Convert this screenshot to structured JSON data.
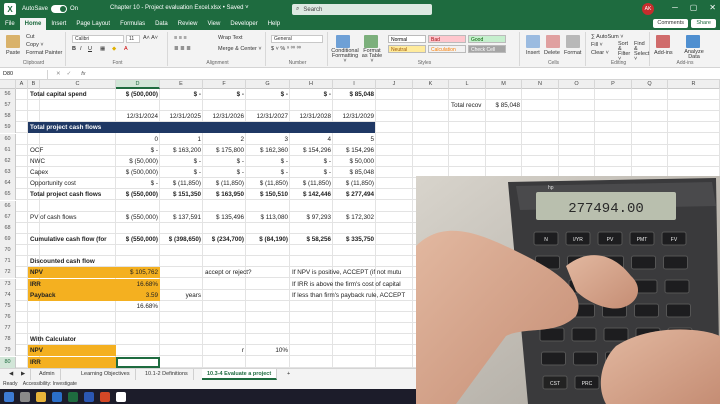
{
  "titlebar": {
    "autosave_label": "AutoSave",
    "autosave_state": "On",
    "doc_title": "Chapter 10 - Project evaluation Excel.xlsx  •  Saved ˅",
    "search_placeholder": "Search",
    "user_initials": "AK"
  },
  "menu": {
    "tabs": [
      "File",
      "Home",
      "Insert",
      "Page Layout",
      "Formulas",
      "Data",
      "Review",
      "View",
      "Developer",
      "Help"
    ],
    "active": "Home",
    "comments_label": "Comments",
    "share_label": "Share"
  },
  "ribbon": {
    "clipboard": {
      "paste": "Paste",
      "cut": "Cut",
      "copy": "Copy ˅",
      "format_painter": "Format Painter",
      "label": "Clipboard"
    },
    "font": {
      "name": "Calibri",
      "size": "11",
      "label": "Font"
    },
    "alignment": {
      "wrap": "Wrap Text",
      "merge": "Merge & Center ˅",
      "label": "Alignment"
    },
    "number": {
      "format": "General",
      "symbols": "$ ˅ % ⁹ ⁰⁰ ⁰⁰",
      "label": "Number"
    },
    "styles": {
      "conditional": "Conditional Formatting ˅",
      "format_table": "Format as Table ˅",
      "label": "Styles",
      "cells": [
        {
          "name": "Normal",
          "bg": "#ffffff",
          "fg": "#000000"
        },
        {
          "name": "Bad",
          "bg": "#ffc7ce",
          "fg": "#9c0006"
        },
        {
          "name": "Good",
          "bg": "#c6efce",
          "fg": "#006100"
        },
        {
          "name": "Neutral",
          "bg": "#ffeb9c",
          "fg": "#9c5700"
        },
        {
          "name": "Calculation",
          "bg": "#f2f2f2",
          "fg": "#fa7d00"
        },
        {
          "name": "Check Cell",
          "bg": "#a5a5a5",
          "fg": "#ffffff"
        }
      ]
    },
    "cells_group": {
      "insert": "Insert",
      "delete": "Delete",
      "format": "Format",
      "label": "Cells"
    },
    "editing": {
      "autosum": "∑ AutoSum ˅",
      "fill": "Fill ˅",
      "clear": "Clear ˅",
      "sort": "Sort & Filter ˅",
      "find": "Find & Select ˅",
      "label": "Editing"
    },
    "addins": {
      "addins": "Add-ins",
      "analyze": "Analyze Data",
      "label": "Add-ins"
    }
  },
  "formula_bar": {
    "name_box": "D80",
    "fx": "fx",
    "content": ""
  },
  "columns": [
    "A",
    "B",
    "C",
    "D",
    "E",
    "F",
    "G",
    "H",
    "I",
    "J",
    "K",
    "L",
    "M",
    "N",
    "O",
    "P",
    "Q",
    "R"
  ],
  "selected_column": "D",
  "selected_row": "80",
  "rows": [
    {
      "n": "56",
      "cells": {
        "A": "Total capital spend",
        "D": "$ (500,000)",
        "E": "$          -",
        "F": "$          -",
        "G": "$          -",
        "H": "$          -",
        "I": "$    85,048",
        "L": "",
        "M": ""
      }
    },
    {
      "n": "57",
      "cells": {
        "L": "Total recov",
        "M": "$      85,048"
      }
    },
    {
      "n": "58",
      "cells": {
        "D": "12/31/2024",
        "E": "12/31/2025",
        "F": "12/31/2026",
        "G": "12/31/2027",
        "H": "12/31/2028",
        "I": "12/31/2029"
      }
    },
    {
      "n": "59",
      "cells": {
        "A": "Total project cash flows"
      }
    },
    {
      "n": "60",
      "cells": {
        "D": "0",
        "E": "1",
        "F": "2",
        "G": "3",
        "H": "4",
        "I": "5"
      }
    },
    {
      "n": "61",
      "cells": {
        "A": "OCF",
        "D": "$          -",
        "E": "$  163,200",
        "F": "$  175,800",
        "G": "$  162,360",
        "H": "$  154,296",
        "I": "$  154,296"
      }
    },
    {
      "n": "62",
      "cells": {
        "A": "NWC",
        "D": "$          (50,000)",
        "E": "$          -",
        "F": "$          -",
        "G": "$          -",
        "H": "$          -",
        "I": "$    50,000"
      }
    },
    {
      "n": "63",
      "cells": {
        "A": "Capex",
        "D": "$  (500,000)",
        "E": "$          -",
        "F": "$          -",
        "G": "$          -",
        "H": "$          -",
        "I": "$    85,048"
      }
    },
    {
      "n": "64",
      "cells": {
        "A": "Opportunity cost",
        "D": "$          -",
        "E": "$  (11,850)",
        "F": "$  (11,850)",
        "G": "$  (11,850)",
        "H": "$  (11,850)",
        "I": "$  (11,850)"
      }
    },
    {
      "n": "65",
      "cells": {
        "A": "Total project cash flows",
        "D": "$  (550,000)",
        "E": "$  151,350",
        "F": "$  163,950",
        "G": "$  150,510",
        "H": "$  142,446",
        "I": "$  277,494"
      }
    },
    {
      "n": "66",
      "cells": {}
    },
    {
      "n": "67",
      "cells": {
        "A": "PV of cash flows",
        "D": "$  (550,000)",
        "E": "$  137,591",
        "F": "$  135,496",
        "G": "$  113,080",
        "H": "$    97,293",
        "I": "$  172,302"
      }
    },
    {
      "n": "68",
      "cells": {}
    },
    {
      "n": "69",
      "cells": {
        "A": "Cumulative cash flow (for",
        "D": "$  (550,000)",
        "E": "$  (398,650)",
        "F": "$  (234,700)",
        "G": "$    (84,190)",
        "H": "$    58,256",
        "I": "$  335,750"
      }
    },
    {
      "n": "70",
      "cells": {}
    },
    {
      "n": "71",
      "cells": {
        "A": "Discounted cash flow"
      }
    },
    {
      "n": "72",
      "cells": {
        "A": "NPV",
        "D": "$    105,762",
        "F": "accept or reject?",
        "H": "If NPV is positive, ACCEPT (if not mutu"
      }
    },
    {
      "n": "73",
      "cells": {
        "A": "IRR",
        "D": "16.68%",
        "H": "If IRR is above the firm's cost of capital"
      }
    },
    {
      "n": "74",
      "cells": {
        "A": "Payback",
        "D": "3.59",
        "E": "years",
        "H": "If less than firm's payback rule, ACCEPT"
      }
    },
    {
      "n": "75",
      "cells": {
        "D": "16.68%"
      }
    },
    {
      "n": "76",
      "cells": {}
    },
    {
      "n": "77",
      "cells": {}
    },
    {
      "n": "78",
      "cells": {
        "A": "With Calculator"
      }
    },
    {
      "n": "79",
      "cells": {
        "A": "NPV",
        "F": "r",
        "G": "10%"
      }
    },
    {
      "n": "80",
      "cells": {
        "A": "IRR"
      }
    }
  ],
  "sheet_tabs": [
    "Admin",
    "Learning Objectives",
    "10.1-2 Definitions",
    "10.3-4 Evaluate a project"
  ],
  "active_sheet": "10.3-4 Evaluate a project",
  "status": {
    "ready": "Ready",
    "accessibility": "Accessibility: Investigate"
  },
  "calculator": {
    "brand": "hp",
    "display": "277494.00",
    "key_labels": [
      "N",
      "I/YR",
      "PV",
      "PMT",
      "FV",
      "CST",
      "PRC",
      "MAR",
      "ON",
      "OFF"
    ]
  },
  "colors": {
    "excel_green": "#1e6b3f",
    "navy": "#1f3864",
    "orange": "#f4b020"
  }
}
